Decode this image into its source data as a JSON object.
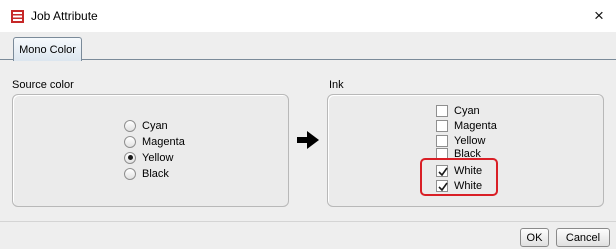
{
  "window": {
    "title": "Job Attribute",
    "close_glyph": "×",
    "app_icon": "printer-app-icon"
  },
  "tabs": [
    {
      "label": "Mono Color",
      "selected": true
    }
  ],
  "source_color": {
    "label": "Source color",
    "options": [
      {
        "label": "Cyan",
        "selected": false
      },
      {
        "label": "Magenta",
        "selected": false
      },
      {
        "label": "Yellow",
        "selected": true
      },
      {
        "label": "Black",
        "selected": false
      }
    ]
  },
  "arrow_icon": "right-arrow-icon",
  "ink": {
    "label": "Ink",
    "options": [
      {
        "label": "Cyan",
        "checked": false
      },
      {
        "label": "Magenta",
        "checked": false
      },
      {
        "label": "Yellow",
        "checked": false
      },
      {
        "label": "Black",
        "checked": false
      },
      {
        "label": "White",
        "checked": true
      },
      {
        "label": "White",
        "checked": true
      }
    ],
    "highlight_color": "#d91f26"
  },
  "buttons": {
    "ok": "OK",
    "cancel": "Cancel"
  }
}
